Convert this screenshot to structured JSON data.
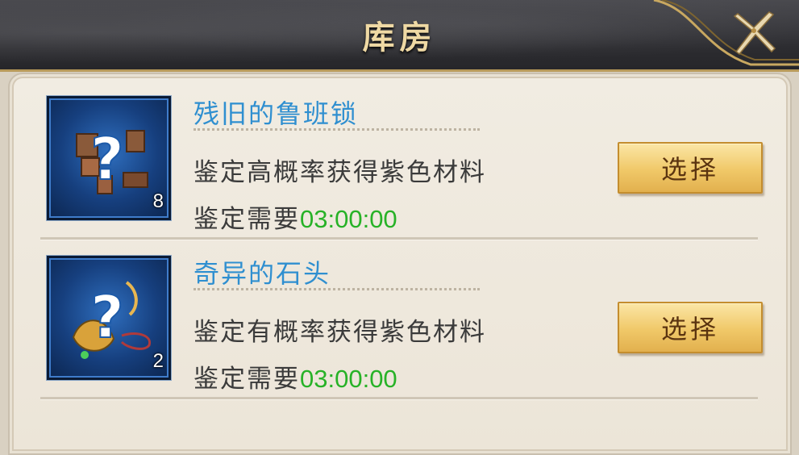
{
  "window": {
    "title": "库房",
    "close_icon": "close-x-icon"
  },
  "items": [
    {
      "name": "残旧的鲁班锁",
      "icon": "unknown-item-question-icon",
      "count": "8",
      "description": "鉴定高概率获得紫色材料",
      "need_label": "鉴定需要",
      "need_time": "03:00:00",
      "button_label": "选择"
    },
    {
      "name": "奇异的石头",
      "icon": "unknown-item-question-icon",
      "count": "2",
      "description": "鉴定有概率获得紫色材料",
      "need_label": "鉴定需要",
      "need_time": "03:00:00",
      "button_label": "选择"
    }
  ],
  "colors": {
    "item_name": "#2f8fd0",
    "time_text": "#27b227",
    "title_text": "#efd9a4",
    "button_face": "#f0c868"
  }
}
